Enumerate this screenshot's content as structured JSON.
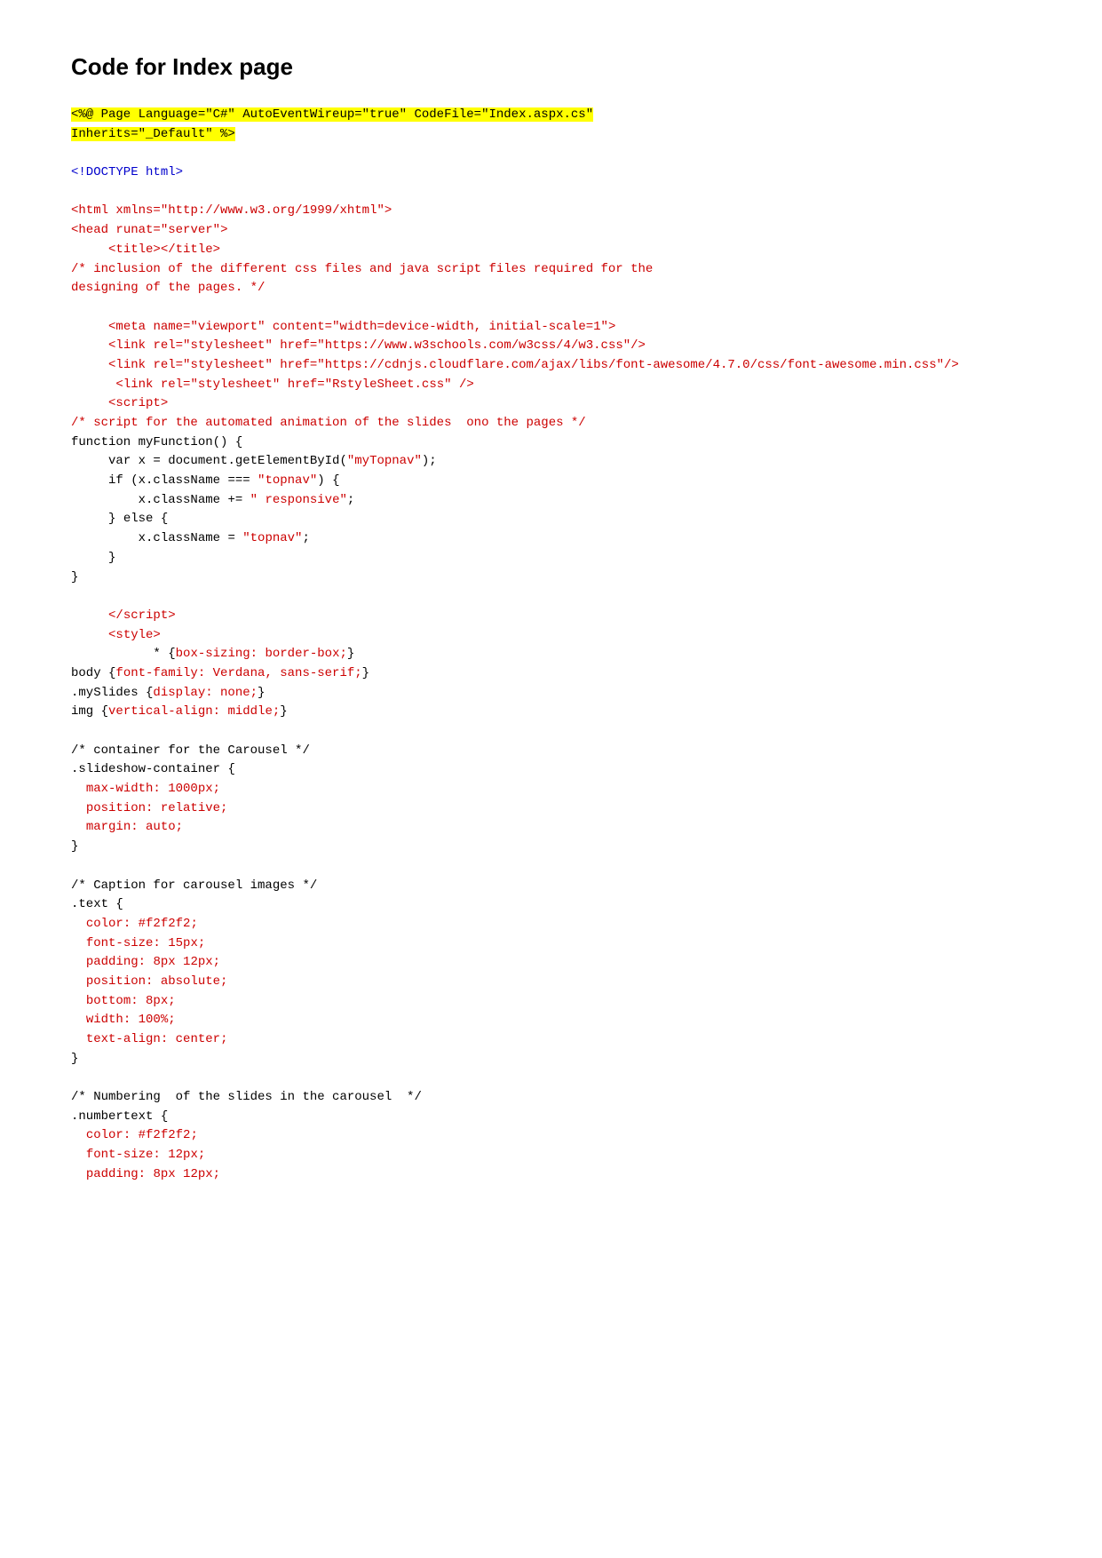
{
  "page": {
    "title": "Code for Index page",
    "code_lines": []
  }
}
